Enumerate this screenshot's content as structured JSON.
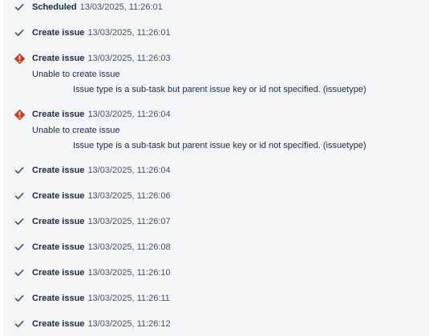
{
  "colors": {
    "panel_background": "#f4f5f7",
    "text_primary": "#172b4d",
    "text_secondary": "#42526e",
    "success_icon": "#42526e",
    "error_icon": "#de350b"
  },
  "audit_log": {
    "entries": [
      {
        "status": "success",
        "icon": "check-icon",
        "action": "Scheduled",
        "timestamp": "13/03/2025, 11:26:01"
      },
      {
        "status": "success",
        "icon": "check-icon",
        "action": "Create issue",
        "timestamp": "13/03/2025, 11:26:01"
      },
      {
        "status": "error",
        "icon": "error-icon",
        "action": "Create issue",
        "timestamp": "13/03/2025, 11:26:03",
        "message": "Unable to create issue",
        "detail": "Issue type is a sub-task but parent issue key or id not specified. (issuetype)"
      },
      {
        "status": "error",
        "icon": "error-icon",
        "action": "Create issue",
        "timestamp": "13/03/2025, 11:26:04",
        "message": "Unable to create issue",
        "detail": "Issue type is a sub-task but parent issue key or id not specified. (issuetype)"
      },
      {
        "status": "success",
        "icon": "check-icon",
        "action": "Create issue",
        "timestamp": "13/03/2025, 11:26:04"
      },
      {
        "status": "success",
        "icon": "check-icon",
        "action": "Create issue",
        "timestamp": "13/03/2025, 11:26:06"
      },
      {
        "status": "success",
        "icon": "check-icon",
        "action": "Create issue",
        "timestamp": "13/03/2025, 11:26:07"
      },
      {
        "status": "success",
        "icon": "check-icon",
        "action": "Create issue",
        "timestamp": "13/03/2025, 11:26:08"
      },
      {
        "status": "success",
        "icon": "check-icon",
        "action": "Create issue",
        "timestamp": "13/03/2025, 11:26:10"
      },
      {
        "status": "success",
        "icon": "check-icon",
        "action": "Create issue",
        "timestamp": "13/03/2025, 11:26:11"
      },
      {
        "status": "success",
        "icon": "check-icon",
        "action": "Create issue",
        "timestamp": "13/03/2025, 11:26:12"
      }
    ]
  }
}
